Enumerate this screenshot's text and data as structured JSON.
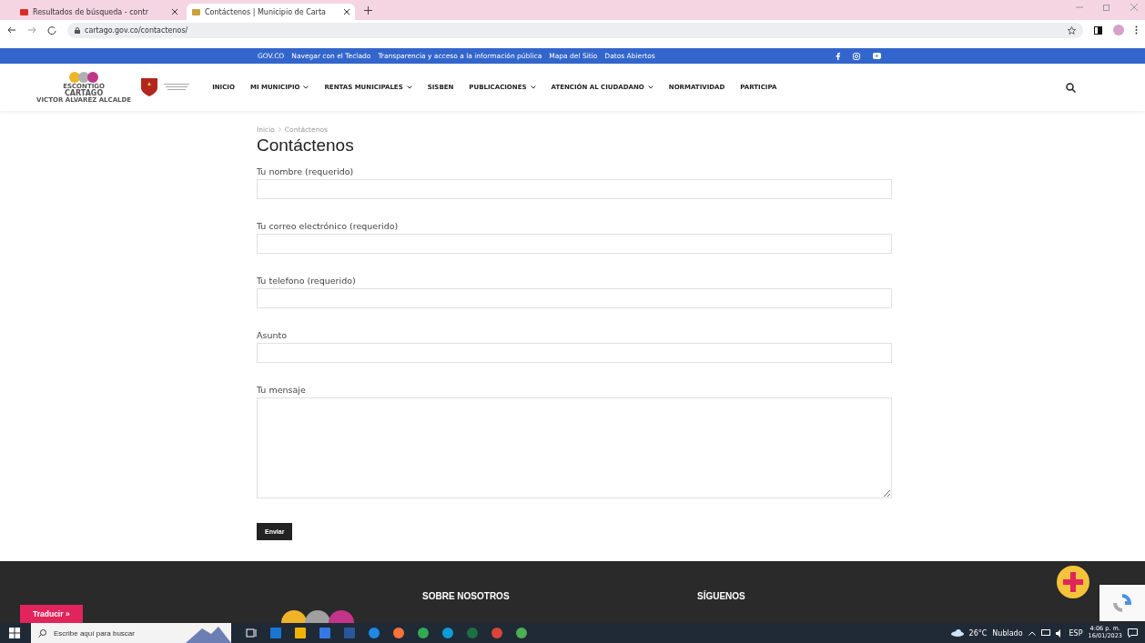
{
  "browser": {
    "tabs": [
      {
        "title": "Resultados de búsqueda - contr",
        "selected": false
      },
      {
        "title": "Contáctenos | Municipio de Carta",
        "selected": true
      }
    ],
    "url": "cartago.gov.co/contactenos/"
  },
  "top_bar": {
    "links": [
      "GOV.CO",
      "Navegar con el Teclado",
      "Transparencia y acceso a la información pública",
      "Mapa del Sitio",
      "Datos Abiertos"
    ]
  },
  "header": {
    "logo_lines": [
      "ESCONTIGO",
      "CARTAGO",
      "VICTOR ÁLVAREZ ALCALDE"
    ],
    "nav": [
      {
        "label": "INICIO",
        "dropdown": false
      },
      {
        "label": "MI MUNICIPIO",
        "dropdown": true
      },
      {
        "label": "RENTAS MUNICIPALES",
        "dropdown": true
      },
      {
        "label": "SISBEN",
        "dropdown": false
      },
      {
        "label": "PUBLICACIONES",
        "dropdown": true
      },
      {
        "label": "ATENCIÓN AL CIUDADANO",
        "dropdown": true
      },
      {
        "label": "NORMATIVIDAD",
        "dropdown": false
      },
      {
        "label": "PARTICIPA",
        "dropdown": false
      }
    ]
  },
  "breadcrumb": [
    "Inicio",
    "Contáctenos"
  ],
  "title": "Contáctenos",
  "form": {
    "fields": [
      {
        "label": "Tu nombre (requerido)",
        "kind": "input"
      },
      {
        "label": "Tu correo electrónico (requerido)",
        "kind": "input"
      },
      {
        "label": "Tu telefono (requerido)",
        "kind": "input"
      },
      {
        "label": "Asunto",
        "kind": "input"
      },
      {
        "label": "Tu mensaje",
        "kind": "textarea"
      }
    ],
    "submit": "Enviar"
  },
  "footer": {
    "headings": [
      "SOBRE NOSOTROS",
      "SÍGUENOS"
    ],
    "translate": "Traducir »"
  },
  "taskbar": {
    "search": {
      "placeholder": "Escribe aquí para buscar"
    },
    "temperature": "26°C",
    "weather": "Nublado",
    "language": "ESP",
    "time": "4:06 p. m.",
    "date": "16/01/2023"
  }
}
